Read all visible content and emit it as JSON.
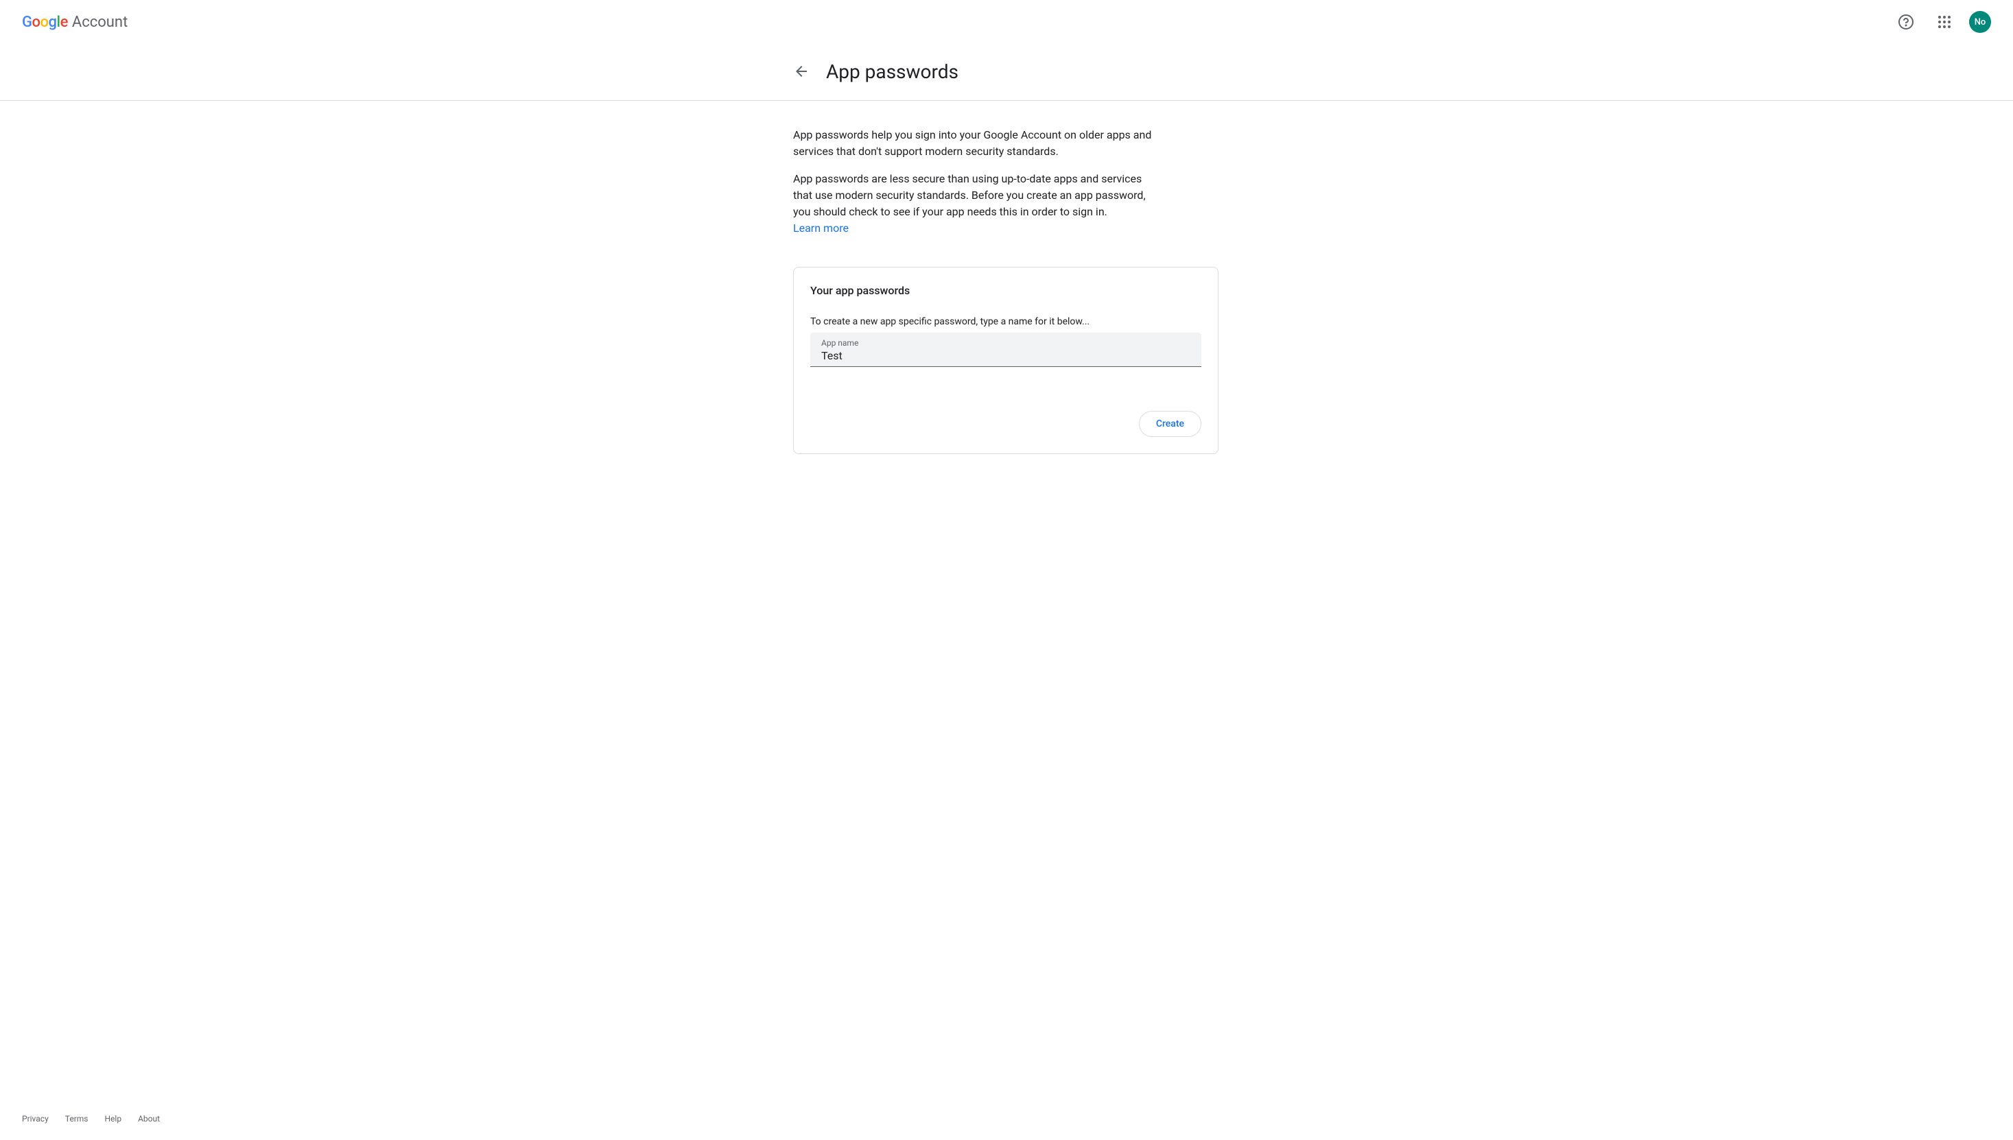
{
  "header": {
    "logo_account": "Account",
    "avatar_initials": "No"
  },
  "page": {
    "title": "App passwords",
    "description1": "App passwords help you sign into your Google Account on older apps and services that don't support modern security standards.",
    "description2": "App passwords are less secure than using up-to-date apps and services that use modern security standards. Before you create an app password, you should check to see if your app needs this in order to sign in.",
    "learn_more": "Learn more"
  },
  "card": {
    "title": "Your app passwords",
    "subtitle": "To create a new app specific password, type a name for it below...",
    "input_label": "App name",
    "input_value": "Test",
    "create_button": "Create"
  },
  "footer": {
    "privacy": "Privacy",
    "terms": "Terms",
    "help": "Help",
    "about": "About"
  }
}
